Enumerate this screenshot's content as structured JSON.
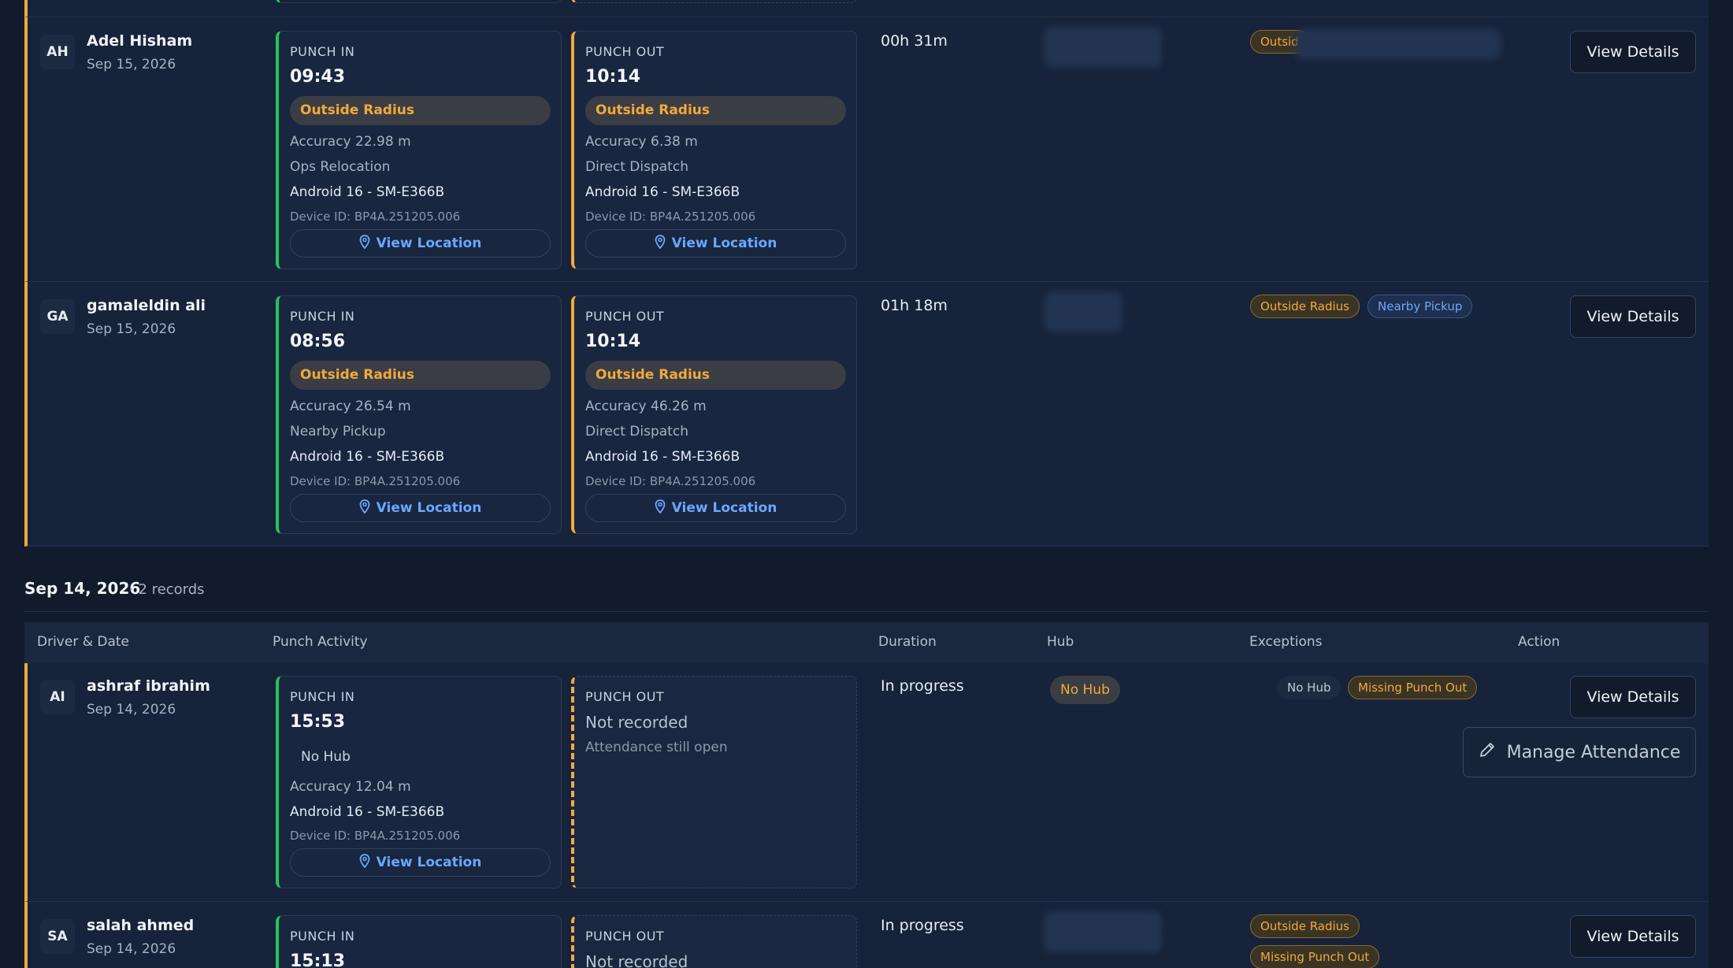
{
  "labels": {
    "punch_in": "PUNCH IN",
    "punch_out": "PUNCH OUT",
    "view_location": "View Location",
    "view_details": "View Details"
  },
  "rows": [
    {
      "initials": "AH",
      "name": "Adel Hisham",
      "date": "Sep 15, 2026",
      "in": {
        "time": "09:43",
        "status": "Outside Radius",
        "accuracy": "Accuracy 22.98 m",
        "reason": "Ops Relocation",
        "device": "Android 16 - SM-E366B",
        "device_id": "Device ID: BP4A.251205.006"
      },
      "out": {
        "time": "10:14",
        "status": "Outside Radius",
        "accuracy": "Accuracy 6.38 m",
        "reason": "Direct Dispatch",
        "device": "Android 16 - SM-E366B",
        "device_id": "Device ID: BP4A.251205.006"
      },
      "duration": "00h 31m",
      "exceptions": [
        "Outsid"
      ]
    },
    {
      "initials": "GA",
      "name": "gamaleldin ali",
      "date": "Sep 15, 2026",
      "in": {
        "time": "08:56",
        "status": "Outside Radius",
        "accuracy": "Accuracy 26.54 m",
        "reason": "Nearby Pickup",
        "device": "Android 16 - SM-E366B",
        "device_id": "Device ID: BP4A.251205.006"
      },
      "out": {
        "time": "10:14",
        "status": "Outside Radius",
        "accuracy": "Accuracy 46.26 m",
        "reason": "Direct Dispatch",
        "device": "Android 16 - SM-E366B",
        "device_id": "Device ID: BP4A.251205.006"
      },
      "duration": "01h 18m",
      "exceptions": [
        "Outside Radius",
        "Nearby Pickup"
      ]
    },
    {
      "initials": "AI",
      "name": "ashraf ibrahim",
      "date": "Sep 14, 2026",
      "in": {
        "time": "15:53",
        "status": "No Hub",
        "accuracy": "Accuracy 12.04 m",
        "device": "Android 16 - SM-E366B",
        "device_id": "Device ID: BP4A.251205.006"
      },
      "out": {
        "not_recorded": "Not recorded",
        "note": "Attendance still open"
      },
      "duration": "In progress",
      "hub": "No Hub",
      "exceptions": [
        "No Hub",
        "Missing Punch Out"
      ],
      "manage": "Manage Attendance"
    },
    {
      "initials": "SA",
      "name": "salah ahmed",
      "date": "Sep 14, 2026",
      "in": {
        "time": "15:13"
      },
      "out": {
        "not_recorded": "Not recorded"
      },
      "duration": "In progress",
      "exceptions": [
        "Outside Radius",
        "Missing Punch Out"
      ]
    }
  ],
  "group": {
    "date": "Sep 14, 2026",
    "count": "· 2 records"
  },
  "table_header": {
    "driver_date": "Driver & Date",
    "punch_activity": "Punch Activity",
    "duration": "Duration",
    "hub": "Hub",
    "exceptions": "Exceptions",
    "action": "Action"
  },
  "colors": {
    "accent_orange": "#f3a93b",
    "accent_green": "#22c55e",
    "link_blue": "#6aa8ff",
    "background": "#111b2c"
  }
}
